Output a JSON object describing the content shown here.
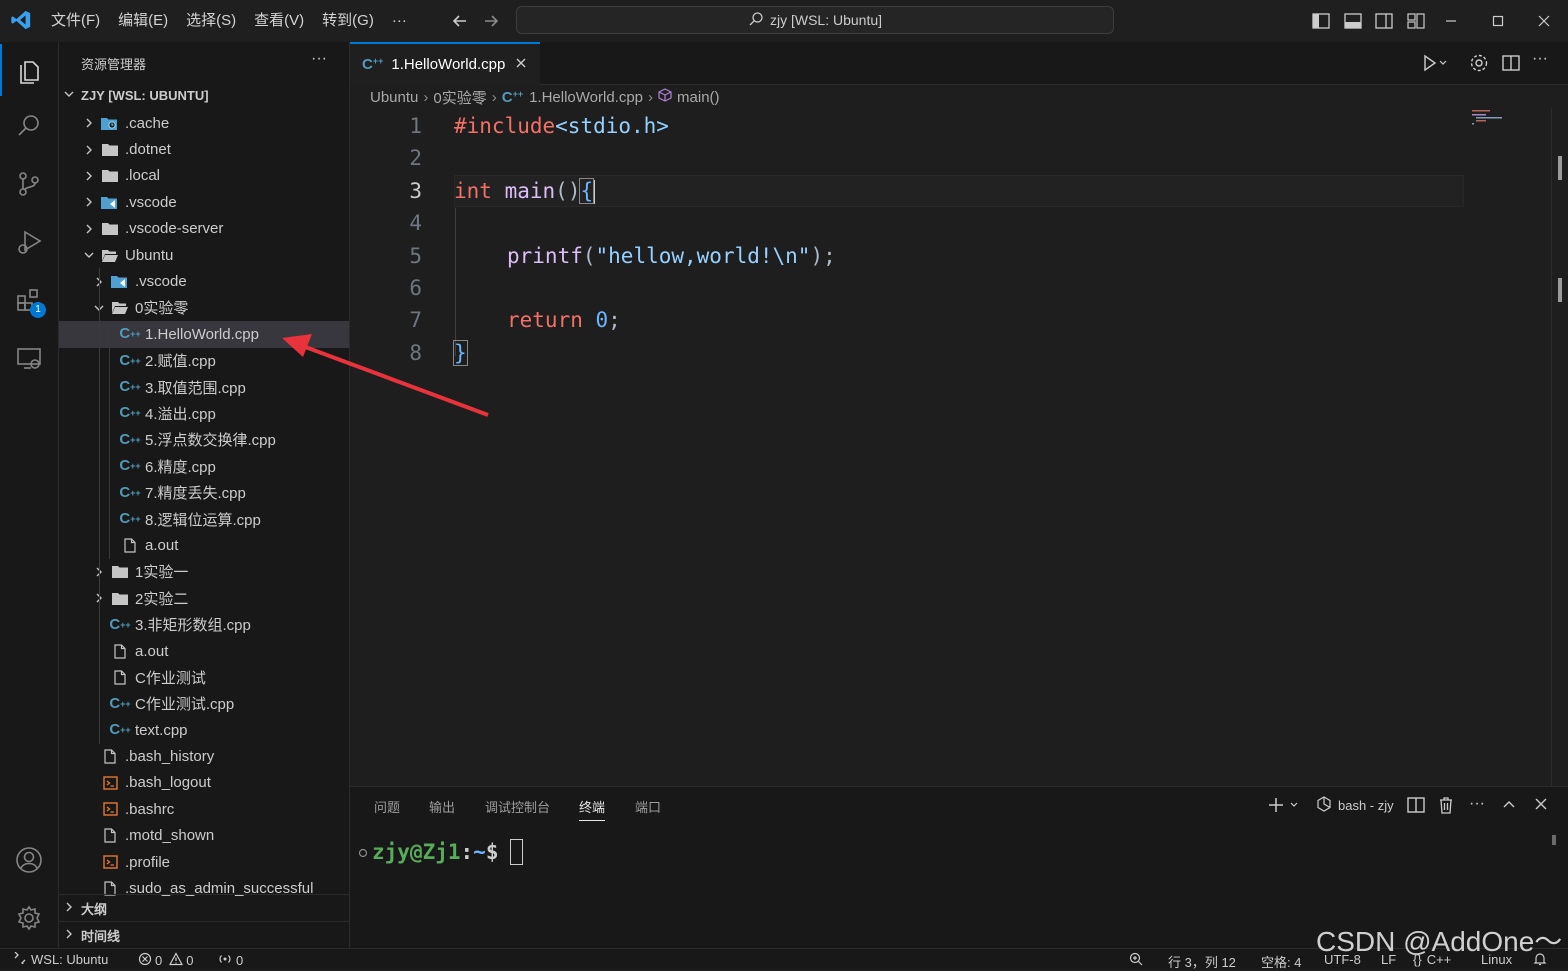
{
  "menu": [
    "文件(F)",
    "编辑(E)",
    "选择(S)",
    "查看(V)",
    "转到(G)",
    "···"
  ],
  "command_center": "zjy [WSL: Ubuntu]",
  "activity_badge": "1",
  "sidebar": {
    "title": "资源管理器",
    "more": "···",
    "root": "ZJY [WSL: UBUNTU]",
    "tree": [
      {
        "label": ".cache",
        "type": "folder-special",
        "depth": 1,
        "expanded": false
      },
      {
        "label": ".dotnet",
        "type": "folder",
        "depth": 1,
        "expanded": false
      },
      {
        "label": ".local",
        "type": "folder",
        "depth": 1,
        "expanded": false
      },
      {
        "label": ".vscode",
        "type": "folder-vscode",
        "depth": 1,
        "expanded": false
      },
      {
        "label": ".vscode-server",
        "type": "folder",
        "depth": 1,
        "expanded": false
      },
      {
        "label": "Ubuntu",
        "type": "folder",
        "depth": 1,
        "expanded": true
      },
      {
        "label": ".vscode",
        "type": "folder-vscode",
        "depth": 2,
        "expanded": false
      },
      {
        "label": "0实验零",
        "type": "folder",
        "depth": 2,
        "expanded": true
      },
      {
        "label": "1.HelloWorld.cpp",
        "type": "cpp",
        "depth": 3,
        "selected": true
      },
      {
        "label": "2.赋值.cpp",
        "type": "cpp",
        "depth": 3
      },
      {
        "label": "3.取值范围.cpp",
        "type": "cpp",
        "depth": 3
      },
      {
        "label": "4.溢出.cpp",
        "type": "cpp",
        "depth": 3
      },
      {
        "label": "5.浮点数交换律.cpp",
        "type": "cpp",
        "depth": 3
      },
      {
        "label": "6.精度.cpp",
        "type": "cpp",
        "depth": 3
      },
      {
        "label": "7.精度丢失.cpp",
        "type": "cpp",
        "depth": 3
      },
      {
        "label": "8.逻辑位运算.cpp",
        "type": "cpp",
        "depth": 3
      },
      {
        "label": "a.out",
        "type": "file",
        "depth": 3
      },
      {
        "label": "1实验一",
        "type": "folder",
        "depth": 2,
        "expanded": false
      },
      {
        "label": "2实验二",
        "type": "folder",
        "depth": 2,
        "expanded": false
      },
      {
        "label": "3.非矩形数组.cpp",
        "type": "cpp",
        "depth": 2
      },
      {
        "label": "a.out",
        "type": "file",
        "depth": 2
      },
      {
        "label": "C作业测试",
        "type": "file",
        "depth": 2
      },
      {
        "label": "C作业测试.cpp",
        "type": "cpp",
        "depth": 2
      },
      {
        "label": "text.cpp",
        "type": "cpp",
        "depth": 2
      },
      {
        "label": ".bash_history",
        "type": "file",
        "depth": 1
      },
      {
        "label": ".bash_logout",
        "type": "shell",
        "depth": 1
      },
      {
        "label": ".bashrc",
        "type": "shell",
        "depth": 1
      },
      {
        "label": ".motd_shown",
        "type": "file",
        "depth": 1
      },
      {
        "label": ".profile",
        "type": "shell",
        "depth": 1
      },
      {
        "label": ".sudo_as_admin_successful",
        "type": "file",
        "depth": 1
      }
    ],
    "outline": "大纲",
    "timeline": "时间线"
  },
  "editor": {
    "tab_label": "1.HelloWorld.cpp",
    "breadcrumb": [
      "Ubuntu",
      "0实验零",
      "1.HelloWorld.cpp",
      "main()"
    ],
    "current_line": "3",
    "lines": [
      "1",
      "2",
      "3",
      "4",
      "5",
      "6",
      "7",
      "8"
    ],
    "code": {
      "include": "#include",
      "header": "<stdio.h>",
      "int_kw": "int",
      "main_fn": "main",
      "main_parens": "()",
      "open_brace": "{",
      "printf_fn": "printf",
      "printf_open": "(",
      "printf_str": "\"hellow,world!\\n\"",
      "printf_close": ")",
      "semicolon": ";",
      "return_kw": "return",
      "return_val": "0",
      "close_brace": "}"
    }
  },
  "panel": {
    "tabs": [
      "问题",
      "输出",
      "调试控制台",
      "终端",
      "端口"
    ],
    "active_tab": "终端",
    "terminal_name": "bash - zjy",
    "prompt_user": "zjy@Zj1",
    "prompt_sep": ":",
    "prompt_path": "~",
    "prompt_char": "$"
  },
  "statusbar": {
    "remote": "WSL: Ubuntu",
    "errors": "0",
    "warnings": "0",
    "ports": "0",
    "position": "行 3，列 12",
    "spaces": "空格: 4",
    "encoding": "UTF-8",
    "eol": "LF",
    "language": "C++",
    "platform": "Linux"
  },
  "watermark": "CSDN @AddOne～",
  "colors": {
    "accent": "#0078d4",
    "keyword": "#f47067",
    "function": "#dcbdfb",
    "string": "#96d0ff",
    "number": "#6cb6ff",
    "cpp_icon": "#519aba",
    "terminal_green": "#57ab5a",
    "annotation_arrow": "#e8323c"
  }
}
